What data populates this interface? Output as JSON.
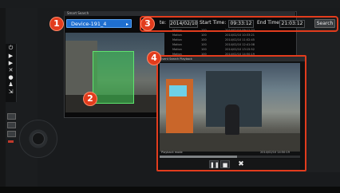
{
  "search_dialog": {
    "title": "Smart Search",
    "camera_select": {
      "value": "Device-191_4"
    },
    "filters": {
      "date_label": "te:",
      "date_value": "2014/02/10",
      "start_label": "Start Time:",
      "start_value": "09:33:12",
      "end_label": "End Time:",
      "end_value": "21:03:12",
      "search_label": "Search"
    },
    "results": [
      {
        "type": "Motion",
        "ch": "100",
        "time": "2014/02/10 09:12:33"
      },
      {
        "type": "Motion",
        "ch": "100",
        "time": "2014/02/10 10:33:21"
      },
      {
        "type": "Motion",
        "ch": "100",
        "time": "2014/02/10 11:02:45"
      },
      {
        "type": "Motion",
        "ch": "100",
        "time": "2014/02/10 12:41:08"
      },
      {
        "type": "Motion",
        "ch": "100",
        "time": "2014/02/10 13:15:52"
      },
      {
        "type": "Motion",
        "ch": "100",
        "time": "2014/02/10 14:50:19"
      }
    ]
  },
  "playback_window": {
    "title": "Event Search Playback",
    "status_left": "Playback mode",
    "status_right": "2014/02/10 14:50:19",
    "progress": 0.55,
    "controls": {
      "pause": "❚❚",
      "stop": "■",
      "close": "✖"
    }
  },
  "markers": [
    "1",
    "2",
    "3",
    "4"
  ],
  "colors": {
    "accent_red": "#e23c1d",
    "select_blue": "#1f6fd0",
    "motion_green": "#5fe36f"
  },
  "toolbar_icons": [
    "power-icon",
    "play-icon",
    "play-frame-icon",
    "tools-icon",
    "info-icon",
    "user-icon",
    "export-icon"
  ]
}
